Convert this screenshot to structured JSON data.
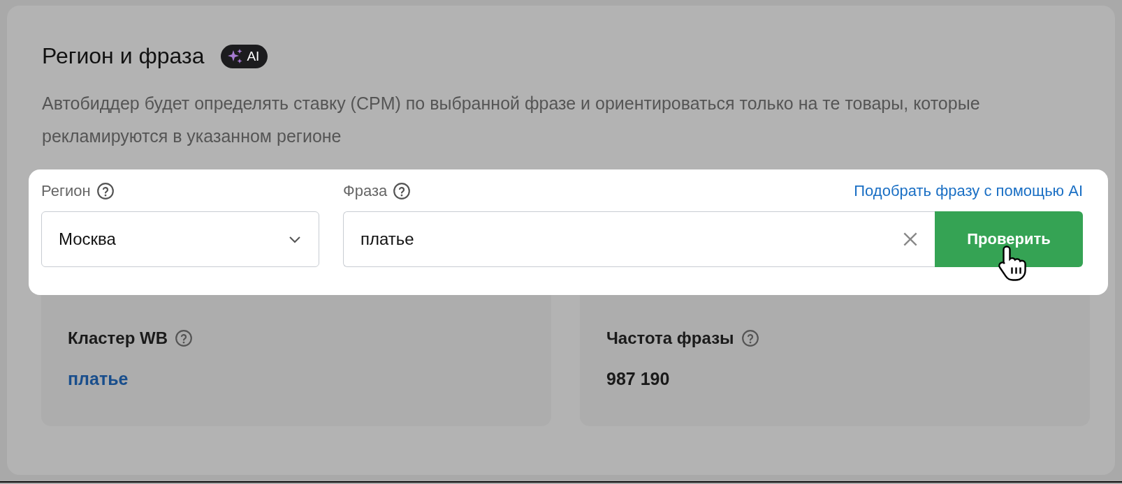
{
  "section": {
    "title": "Регион и фраза",
    "badge": "AI",
    "description": "Автобиддер будет определять ставку (CPM) по выбранной фразе и ориентироваться только на те товары, которые рекламируются в указанном регионе"
  },
  "form": {
    "region": {
      "label": "Регион",
      "value": "Москва"
    },
    "phrase": {
      "label": "Фраза",
      "value": "платье"
    },
    "ai_link": "Подобрать фразу с помощью AI",
    "check_button": "Проверить"
  },
  "stats": [
    {
      "title": "Кластер WB",
      "value": "платье",
      "kind": "link"
    },
    {
      "title": "Частота фразы",
      "value": "987 190",
      "kind": "number"
    }
  ]
}
